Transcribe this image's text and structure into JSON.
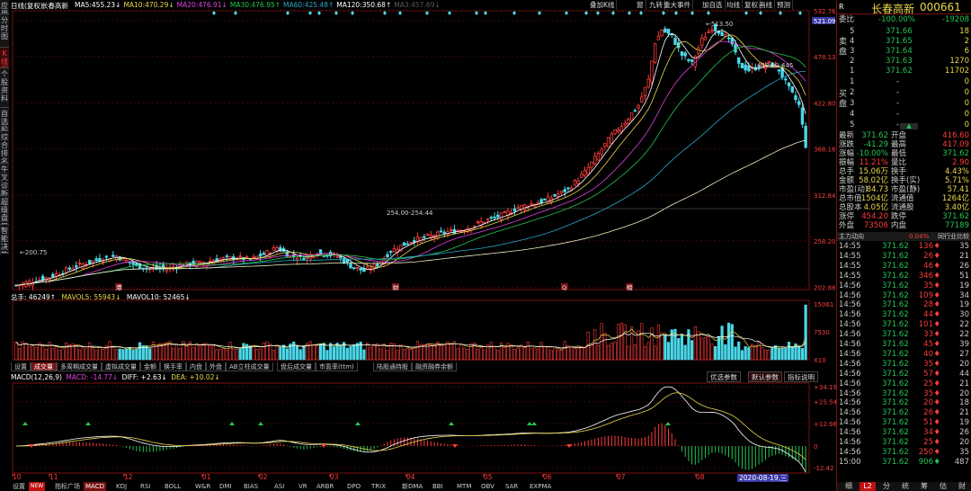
{
  "stock": {
    "name": "长春高新",
    "code": "000661"
  },
  "toolbar": {
    "period": "日线(复权)",
    "mas": [
      {
        "label": "MA5:",
        "value": "455.23↓"
      },
      {
        "label": "MA10:",
        "value": "470.29↓"
      },
      {
        "label": "MA20:",
        "value": "476.91↓"
      },
      {
        "label": "MA30:",
        "value": "476.95↑"
      },
      {
        "label": "MA60:",
        "value": "425.48↑"
      },
      {
        "label": "MA120:",
        "value": "350.68↑"
      },
      {
        "label": "MA3:",
        "value": "457.69↓"
      }
    ],
    "buttons": [
      "叠加K线",
      "窗",
      "九转",
      "重大事件",
      "加自选",
      "均线",
      "复权",
      "画线",
      "预测"
    ]
  },
  "left_tabs": [
    "应用",
    "分时图",
    "K线图",
    "个股资料",
    "自选股",
    "综合排名",
    "牛叉诊断",
    "超级盘口",
    "智能决策"
  ],
  "volume_header": {
    "total": "总手: 46249↑",
    "mav5": "MAVOL5: 55943↓",
    "mav10": "MAVOL10: 52465↓"
  },
  "bottom_tabs": [
    "设置",
    "成交量",
    "多周期成交量",
    "虚拟成交量",
    "金额",
    "换手率",
    "内盘",
    "外盘",
    "AB立柱成交量",
    "盘后成交量",
    "市盈率(ttm)",
    "陆股通持股",
    "融资融券余额"
  ],
  "macd_header": {
    "label": "MACD(12,26,9)",
    "macd": "MACD: -14.77↓",
    "diff": "DIFF: +2.63↓",
    "dea": "DEA: +10.02↓"
  },
  "macd_buttons": [
    "优选参数",
    "默认参数",
    "指标说明"
  ],
  "indicator_bar": [
    "设置",
    "NEW",
    "指标广场",
    "MACD",
    "KDJ",
    "RSI",
    "BOLL",
    "W&R",
    "DMI",
    "BIAS",
    "ASI",
    "VR",
    "ARBR",
    "DPO",
    "TRIX",
    "新DMA",
    "BBI",
    "MTM",
    "OBV",
    "SAR",
    "EXPMA"
  ],
  "date_badge": "2020-08-19,三",
  "month_labels": [
    "10",
    "11",
    "12",
    "01",
    "02",
    "03",
    "04",
    "05",
    "06",
    "07",
    "08",
    "09"
  ],
  "price_axis": [
    "532.76",
    "521.09",
    "478.13",
    "422.80",
    "368.16",
    "312.84",
    "258.20",
    "202.88"
  ],
  "volume_axis": [
    "15061",
    "7530",
    "X10"
  ],
  "macd_axis": [
    "+34.19",
    "+25.54",
    "+12.98",
    "0",
    "-12.42"
  ],
  "annotations": {
    "high": "513.50",
    "low": "200.75",
    "mid": "254.00-254.44",
    "right": "448.00-445",
    "events": [
      "港",
      "财",
      "Q",
      "榜"
    ]
  },
  "orderbook": {
    "commit_label": "委比",
    "commit_pct": "-100.00%",
    "commit_vol": "-19208",
    "sell_label": "卖盘",
    "buy_label": "买盘",
    "sells": [
      {
        "n": "5",
        "p": "371.66",
        "v": "18"
      },
      {
        "n": "4",
        "p": "371.65",
        "v": "2"
      },
      {
        "n": "3",
        "p": "371.64",
        "v": "6"
      },
      {
        "n": "2",
        "p": "371.63",
        "v": "1270"
      },
      {
        "n": "1",
        "p": "371.62",
        "v": "11702"
      }
    ],
    "buys": [
      {
        "n": "1",
        "p": "-",
        "v": "0"
      },
      {
        "n": "2",
        "p": "-",
        "v": "0"
      },
      {
        "n": "3",
        "p": "-",
        "v": "0"
      },
      {
        "n": "4",
        "p": "-",
        "v": "0"
      },
      {
        "n": "5",
        "p": "-",
        "v": "0"
      }
    ]
  },
  "quote": [
    [
      "最新",
      "371.62",
      "开盘",
      "416.60"
    ],
    [
      "涨跌",
      "-41.29",
      "最高",
      "417.09"
    ],
    [
      "涨幅",
      "-10.00%",
      "最低",
      "371.62"
    ],
    [
      "振幅",
      "11.21%",
      "量比",
      "2.90"
    ],
    [
      "总手",
      "15.06万",
      "换手",
      "4.43%"
    ],
    [
      "金额",
      "58.02亿",
      "换手(实)",
      "5.71%"
    ],
    [
      "市盈(动)",
      "84.73",
      "市盈(静)",
      "57.41"
    ],
    [
      "总市值",
      "1504亿",
      "流通值",
      "1264亿"
    ],
    [
      "总股本",
      "4.05亿",
      "流通股",
      "3.40亿"
    ],
    [
      "涨停",
      "454.20",
      "跌停",
      "371.62"
    ],
    [
      "外盘",
      "73506",
      "内盘",
      "77189"
    ]
  ],
  "trade_header": {
    "left": "主力动向",
    "pct": "0.04%",
    "right": "同行业比较"
  },
  "trades": [
    [
      "14:55",
      "371.62",
      "136",
      "35"
    ],
    [
      "14:55",
      "371.62",
      "26",
      "21"
    ],
    [
      "14:55",
      "371.62",
      "46",
      "26"
    ],
    [
      "14:55",
      "371.62",
      "346",
      "51"
    ],
    [
      "14:56",
      "371.62",
      "35",
      "19"
    ],
    [
      "14:56",
      "371.62",
      "109",
      "34"
    ],
    [
      "14:56",
      "371.62",
      "28",
      "19"
    ],
    [
      "14:56",
      "371.62",
      "44",
      "30"
    ],
    [
      "14:56",
      "371.62",
      "101",
      "22"
    ],
    [
      "14:56",
      "371.62",
      "33",
      "22"
    ],
    [
      "14:56",
      "371.62",
      "45",
      "39"
    ],
    [
      "14:56",
      "371.62",
      "40",
      "27"
    ],
    [
      "14:56",
      "371.62",
      "35",
      "20"
    ],
    [
      "14:56",
      "371.62",
      "57",
      "44"
    ],
    [
      "14:56",
      "371.62",
      "25",
      "21"
    ],
    [
      "14:56",
      "371.62",
      "35",
      "20"
    ],
    [
      "14:56",
      "371.62",
      "20",
      "18"
    ],
    [
      "14:56",
      "371.62",
      "26",
      "21"
    ],
    [
      "14:56",
      "371.62",
      "51",
      "19"
    ],
    [
      "14:56",
      "371.62",
      "34",
      "26"
    ],
    [
      "14:56",
      "371.62",
      "25",
      "20"
    ],
    [
      "14:56",
      "371.62",
      "250",
      "35"
    ],
    [
      "15:00",
      "371.62",
      "906",
      "487"
    ]
  ],
  "right_tabs": [
    "细",
    "L2",
    "分",
    "统",
    "筹",
    "估",
    "财"
  ],
  "chart_data": {
    "type": "candlestick",
    "indicators": [
      "MA5",
      "MA10",
      "MA20",
      "MA30",
      "MA60",
      "MA120",
      "VOL",
      "MACD"
    ],
    "ylim": [
      200,
      532.76
    ],
    "anchors": [
      [
        0,
        205
      ],
      [
        10,
        215
      ],
      [
        18,
        228
      ],
      [
        25,
        236
      ],
      [
        30,
        240
      ],
      [
        36,
        228
      ],
      [
        40,
        225
      ],
      [
        46,
        226
      ],
      [
        50,
        230
      ],
      [
        56,
        232
      ],
      [
        60,
        236
      ],
      [
        66,
        238
      ],
      [
        70,
        236
      ],
      [
        74,
        242
      ],
      [
        78,
        250
      ],
      [
        82,
        240
      ],
      [
        86,
        238
      ],
      [
        90,
        244
      ],
      [
        96,
        240
      ],
      [
        100,
        228
      ],
      [
        104,
        222
      ],
      [
        108,
        230
      ],
      [
        112,
        246
      ],
      [
        118,
        258
      ],
      [
        122,
        262
      ],
      [
        128,
        268
      ],
      [
        134,
        272
      ],
      [
        140,
        282
      ],
      [
        146,
        290
      ],
      [
        150,
        298
      ],
      [
        154,
        302
      ],
      [
        158,
        306
      ],
      [
        162,
        314
      ],
      [
        165,
        320
      ],
      [
        170,
        340
      ],
      [
        174,
        362
      ],
      [
        178,
        384
      ],
      [
        182,
        400
      ],
      [
        186,
        420
      ],
      [
        189,
        450
      ],
      [
        191,
        495
      ],
      [
        193,
        510
      ],
      [
        196,
        502
      ],
      [
        199,
        480
      ],
      [
        202,
        470
      ],
      [
        205,
        498
      ],
      [
        208,
        513
      ],
      [
        211,
        506
      ],
      [
        214,
        493
      ],
      [
        216,
        468
      ],
      [
        219,
        462
      ],
      [
        222,
        466
      ],
      [
        225,
        470
      ],
      [
        228,
        462
      ],
      [
        231,
        440
      ],
      [
        234,
        420
      ],
      [
        236,
        372
      ]
    ]
  }
}
